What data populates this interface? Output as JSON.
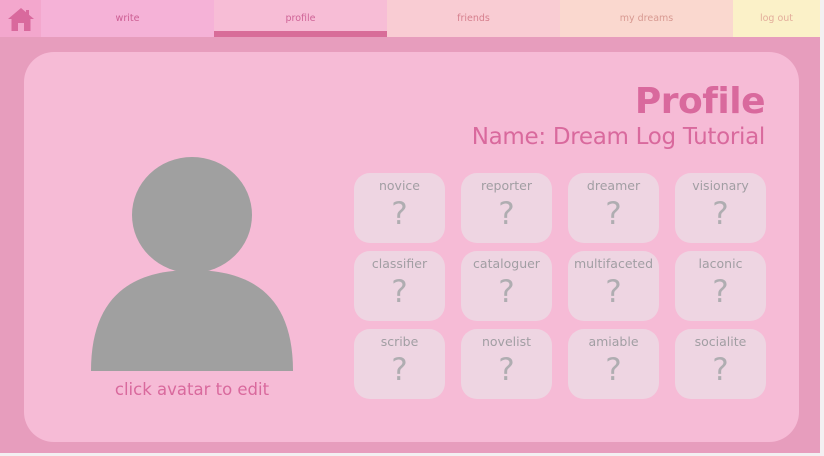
{
  "nav": {
    "home_icon": "home-icon",
    "tabs": [
      {
        "label": "write"
      },
      {
        "label": "profile",
        "active": true
      },
      {
        "label": "friends"
      },
      {
        "label": "my dreams"
      },
      {
        "label": "log out"
      }
    ]
  },
  "profile": {
    "title": "Profile",
    "name_line": "Name: Dream Log Tutorial",
    "avatar_caption": "click avatar to edit"
  },
  "badges": [
    {
      "name": "novice",
      "mark": "?"
    },
    {
      "name": "reporter",
      "mark": "?"
    },
    {
      "name": "dreamer",
      "mark": "?"
    },
    {
      "name": "visionary",
      "mark": "?"
    },
    {
      "name": "classifier",
      "mark": "?"
    },
    {
      "name": "cataloguer",
      "mark": "?"
    },
    {
      "name": "multifaceted",
      "mark": "?"
    },
    {
      "name": "laconic",
      "mark": "?"
    },
    {
      "name": "scribe",
      "mark": "?"
    },
    {
      "name": "novelist",
      "mark": "?"
    },
    {
      "name": "amiable",
      "mark": "?"
    },
    {
      "name": "socialite",
      "mark": "?"
    }
  ],
  "colors": {
    "accent": "#d9699d",
    "background": "#e79dbd",
    "card": "#f6bbd6",
    "badge": "#eed5e2",
    "avatar": "#a0a0a0"
  }
}
